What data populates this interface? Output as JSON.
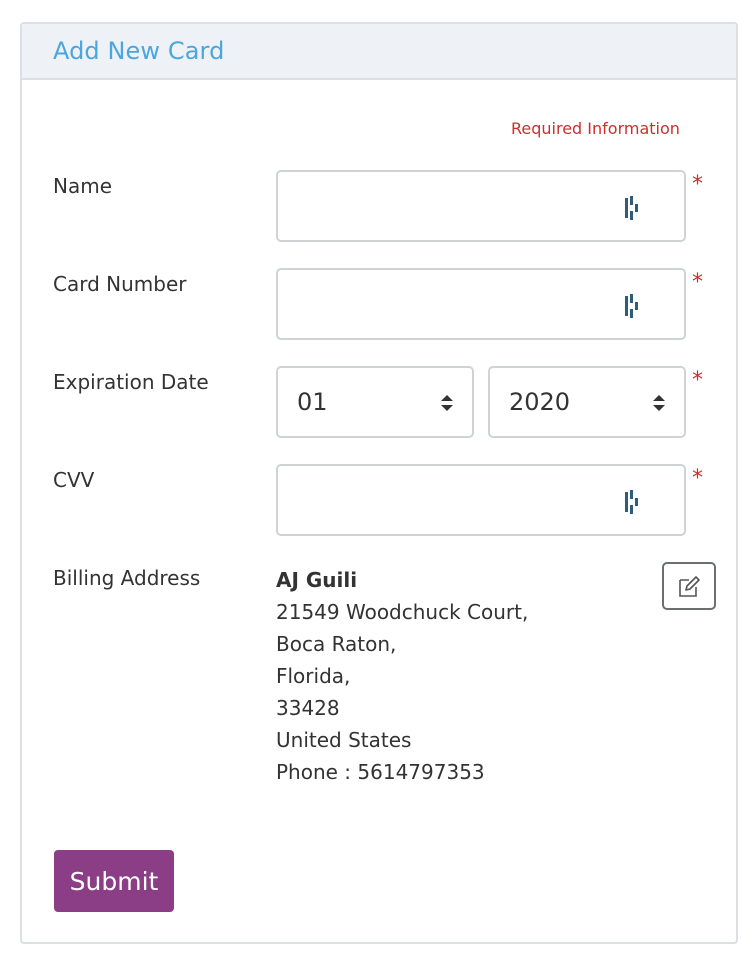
{
  "header": {
    "title": "Add New Card"
  },
  "required_info": "Required Information",
  "fields": {
    "name": {
      "label": "Name",
      "value": "",
      "required_mark": "*",
      "icon": "password-manager-icon"
    },
    "card_number": {
      "label": "Card Number",
      "value": "",
      "required_mark": "*",
      "icon": "password-manager-icon"
    },
    "expiration": {
      "label": "Expiration Date",
      "month": "01",
      "year": "2020",
      "required_mark": "*"
    },
    "cvv": {
      "label": "CVV",
      "value": "",
      "required_mark": "*",
      "icon": "password-manager-icon"
    }
  },
  "billing": {
    "label": "Billing Address",
    "name": "AJ Guili",
    "street": "21549 Woodchuck Court,",
    "city": "Boca Raton,",
    "state": "Florida,",
    "zip": "33428",
    "country": "United States",
    "phone": "Phone : 5614797353",
    "edit_icon": "edit-icon"
  },
  "submit_label": "Submit",
  "colors": {
    "accent": "#4aa6dc",
    "required": "#c9302c",
    "submit": "#8b3e86",
    "icon": "#2f5d78"
  }
}
